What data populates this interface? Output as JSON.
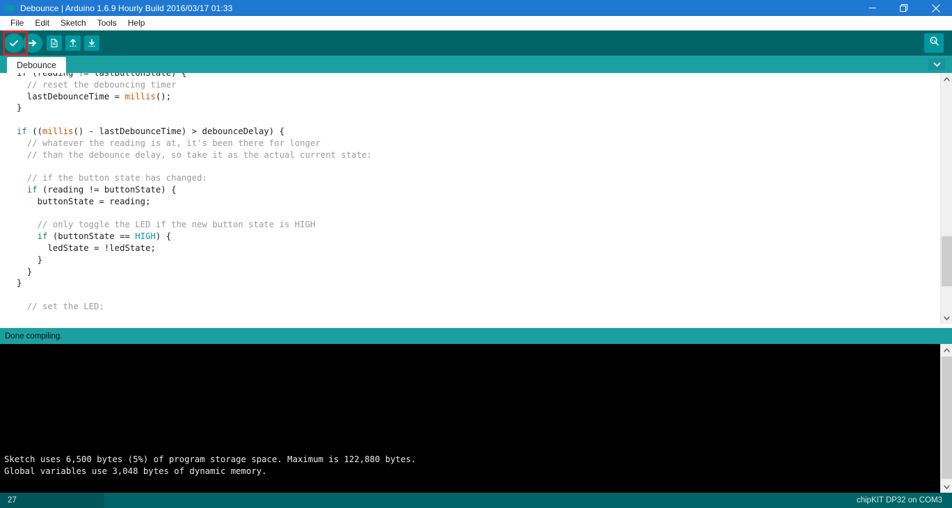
{
  "window": {
    "title": "Debounce | Arduino 1.6.9 Hourly Build 2016/03/17 01:33",
    "app_icon": "arduino-logo-icon",
    "controls": {
      "minimize": "minimize-icon",
      "restore": "restore-icon",
      "close": "close-icon"
    },
    "titlebar_color": "#1f78d1"
  },
  "menubar": {
    "items": [
      {
        "label": "File"
      },
      {
        "label": "Edit"
      },
      {
        "label": "Sketch"
      },
      {
        "label": "Tools"
      },
      {
        "label": "Help"
      }
    ]
  },
  "toolbar": {
    "background": "#006468",
    "buttons": [
      {
        "name": "verify-button",
        "icon": "checkmark-icon",
        "tooltip": "Verify"
      },
      {
        "name": "upload-button",
        "icon": "arrow-right-icon",
        "tooltip": "Upload"
      },
      {
        "name": "new-button",
        "icon": "new-document-icon",
        "tooltip": "New"
      },
      {
        "name": "open-button",
        "icon": "arrow-up-icon",
        "tooltip": "Open"
      },
      {
        "name": "save-button",
        "icon": "arrow-down-icon",
        "tooltip": "Save"
      }
    ],
    "serial_monitor": {
      "name": "serial-monitor-button",
      "icon": "magnifier-icon"
    },
    "highlight": {
      "target": "verify-button",
      "color": "#e31d1d"
    }
  },
  "tabbar": {
    "background": "#1ba0a2",
    "tabs": [
      {
        "label": "Debounce",
        "active": true
      }
    ],
    "menu_icon": "chevron-down-icon"
  },
  "editor": {
    "lines": [
      {
        "segments": [
          {
            "t": "if (reading != lastButtonState) {",
            "c": ""
          }
        ]
      },
      {
        "segments": [
          {
            "t": "  // reset the debouncing timer",
            "c": "cm"
          }
        ]
      },
      {
        "segments": [
          {
            "t": "  lastDebounceTime = ",
            "c": ""
          },
          {
            "t": "millis",
            "c": "fn"
          },
          {
            "t": "();",
            "c": ""
          }
        ]
      },
      {
        "segments": [
          {
            "t": "}",
            "c": ""
          }
        ]
      },
      {
        "segments": [
          {
            "t": "",
            "c": ""
          }
        ]
      },
      {
        "segments": [
          {
            "t": "if ",
            "c": "kw"
          },
          {
            "t": "((",
            "c": ""
          },
          {
            "t": "millis",
            "c": "fn"
          },
          {
            "t": "() - lastDebounceTime) > debounceDelay) {",
            "c": ""
          }
        ]
      },
      {
        "segments": [
          {
            "t": "  // whatever the reading is at, it's been there for longer",
            "c": "cm"
          }
        ]
      },
      {
        "segments": [
          {
            "t": "  // than the debounce delay, so take it as the actual current state:",
            "c": "cm"
          }
        ]
      },
      {
        "segments": [
          {
            "t": "",
            "c": ""
          }
        ]
      },
      {
        "segments": [
          {
            "t": "  // if the button state has changed:",
            "c": "cm"
          }
        ]
      },
      {
        "segments": [
          {
            "t": "  if ",
            "c": "kw"
          },
          {
            "t": "(reading != buttonState) {",
            "c": ""
          }
        ]
      },
      {
        "segments": [
          {
            "t": "    buttonState = reading;",
            "c": ""
          }
        ]
      },
      {
        "segments": [
          {
            "t": "",
            "c": ""
          }
        ]
      },
      {
        "segments": [
          {
            "t": "    // only toggle the LED if the new button state is HIGH",
            "c": "cm"
          }
        ]
      },
      {
        "segments": [
          {
            "t": "    if ",
            "c": "kw"
          },
          {
            "t": "(buttonState == ",
            "c": ""
          },
          {
            "t": "HIGH",
            "c": "cn"
          },
          {
            "t": ") {",
            "c": ""
          }
        ]
      },
      {
        "segments": [
          {
            "t": "      ledState = !ledState;",
            "c": ""
          }
        ]
      },
      {
        "segments": [
          {
            "t": "    }",
            "c": ""
          }
        ]
      },
      {
        "segments": [
          {
            "t": "  }",
            "c": ""
          }
        ]
      },
      {
        "segments": [
          {
            "t": "}",
            "c": ""
          }
        ]
      },
      {
        "segments": [
          {
            "t": "",
            "c": ""
          }
        ]
      },
      {
        "segments": [
          {
            "t": "  // set the LED:",
            "c": "cm"
          }
        ]
      }
    ],
    "scrollbar": {
      "up_icon": "chevron-up-icon",
      "down_icon": "chevron-down-icon"
    }
  },
  "status": {
    "message": "Done compiling.",
    "background": "#1ba0a2"
  },
  "console": {
    "background": "#000000",
    "output": "Sketch uses 6,500 bytes (5%) of program storage space. Maximum is 122,880 bytes.\nGlobal variables use 3,048 bytes of dynamic memory.",
    "scrollbar": {
      "up_icon": "chevron-up-icon",
      "down_icon": "chevron-down-icon"
    }
  },
  "bottombar": {
    "line_number": "27",
    "board_info": "chipKIT DP32 on COM3",
    "background": "#006468"
  }
}
